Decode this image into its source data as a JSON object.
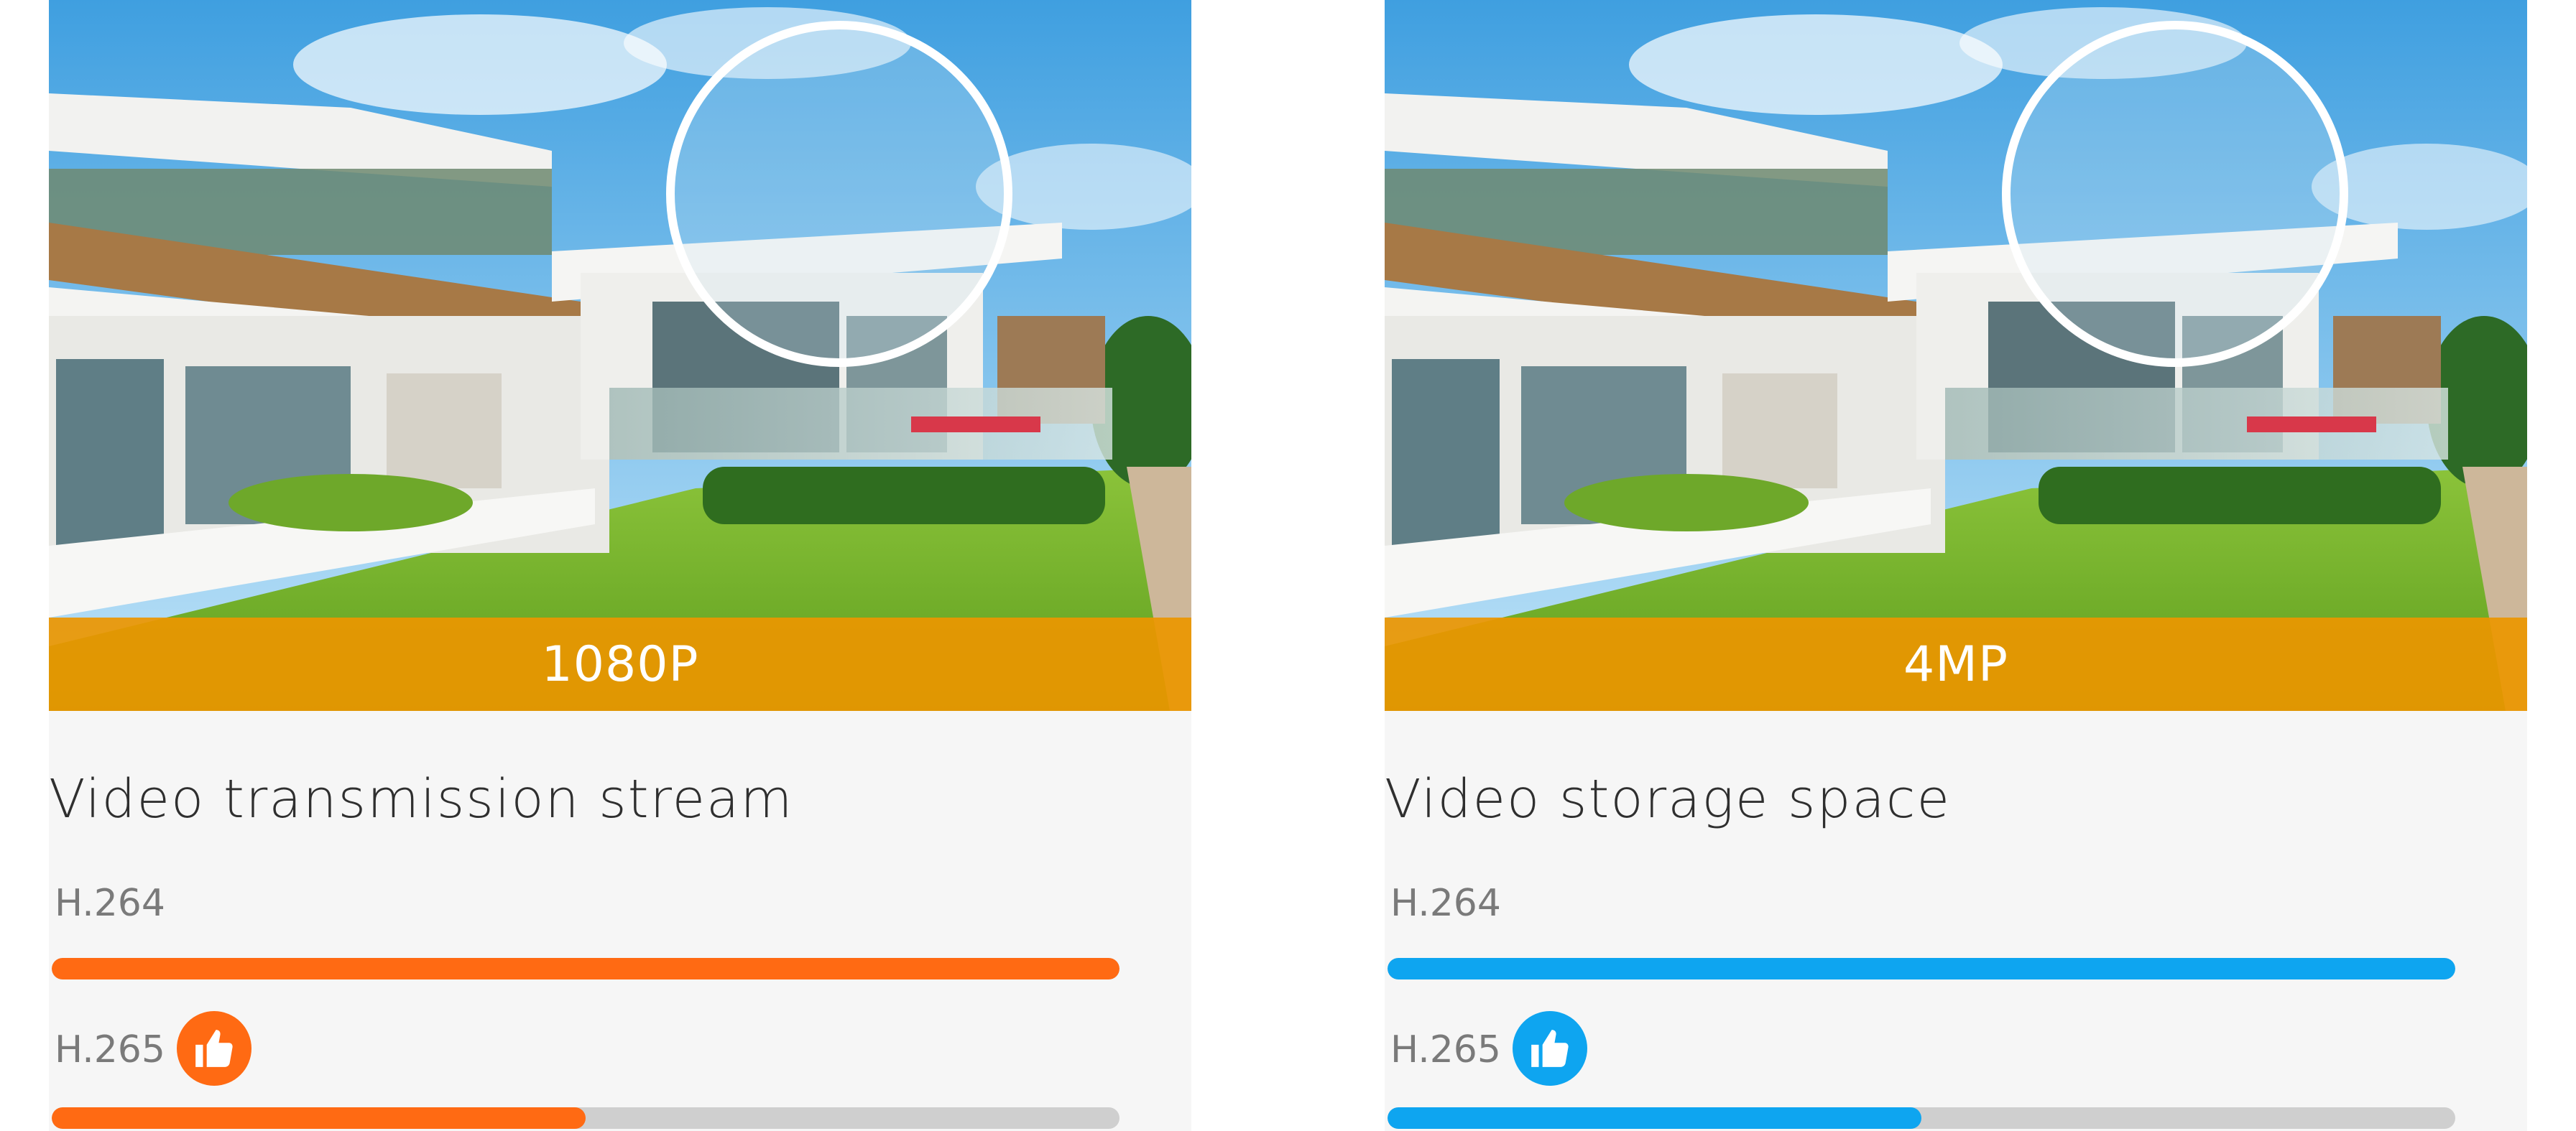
{
  "colors": {
    "orange_bar": "#ff6a13",
    "blue_bar": "#0ea5f0",
    "track": "#cfcfcf",
    "resolution_band": "#ec9600"
  },
  "panels": [
    {
      "resolution_label": "1080P",
      "title": "Video transmission stream",
      "accent_color": "#ff6a13",
      "rows": [
        {
          "label": "H.264",
          "level_fraction": 1.0,
          "recommended": false
        },
        {
          "label": "H.265",
          "level_fraction": 0.5,
          "recommended": true,
          "badge_icon": "thumbs-up-icon"
        }
      ]
    },
    {
      "resolution_label": "4MP",
      "title": "Video storage space",
      "accent_color": "#0ea5f0",
      "rows": [
        {
          "label": "H.264",
          "level_fraction": 1.0,
          "recommended": false
        },
        {
          "label": "H.265",
          "level_fraction": 0.5,
          "recommended": true,
          "badge_icon": "thumbs-up-icon"
        }
      ]
    }
  ]
}
